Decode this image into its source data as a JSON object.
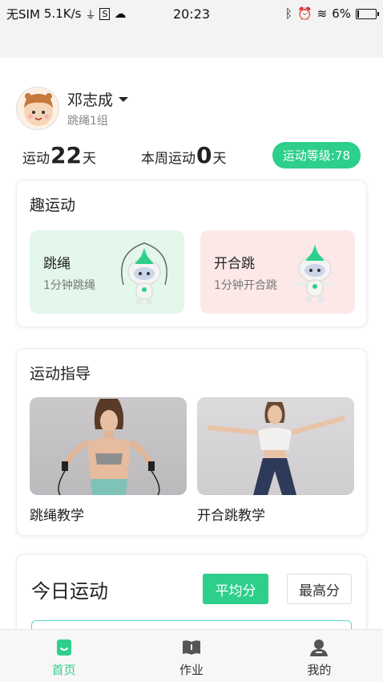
{
  "status_bar": {
    "carrier": "无SIM",
    "speed": "5.1K/s",
    "time": "20:23",
    "battery": "6%",
    "battery_level": 0.06
  },
  "profile": {
    "name": "邓志成",
    "group": "跳绳1组"
  },
  "stats": {
    "exercise_label": "运动",
    "exercise_days": "22",
    "exercise_unit": "天",
    "week_label": "本周运动",
    "week_days": "0",
    "week_unit": "天",
    "level": "运动等级:78"
  },
  "fun_exercise": {
    "title": "趣运动",
    "items": [
      {
        "title": "跳绳",
        "subtitle": "1分钟跳绳"
      },
      {
        "title": "开合跳",
        "subtitle": "1分钟开合跳"
      }
    ]
  },
  "guide": {
    "title": "运动指导",
    "items": [
      {
        "label": "跳绳教学"
      },
      {
        "label": "开合跳教学"
      }
    ]
  },
  "today": {
    "title": "今日运动",
    "avg_label": "平均分",
    "max_label": "最高分"
  },
  "tabs": [
    {
      "label": "首页",
      "icon": "home-icon",
      "active": true
    },
    {
      "label": "作业",
      "icon": "book-icon",
      "active": false
    },
    {
      "label": "我的",
      "icon": "person-icon",
      "active": false
    }
  ],
  "colors": {
    "accent": "#2dcf8a",
    "tile_green": "#e3f7ea",
    "tile_red": "#fde8e8"
  }
}
